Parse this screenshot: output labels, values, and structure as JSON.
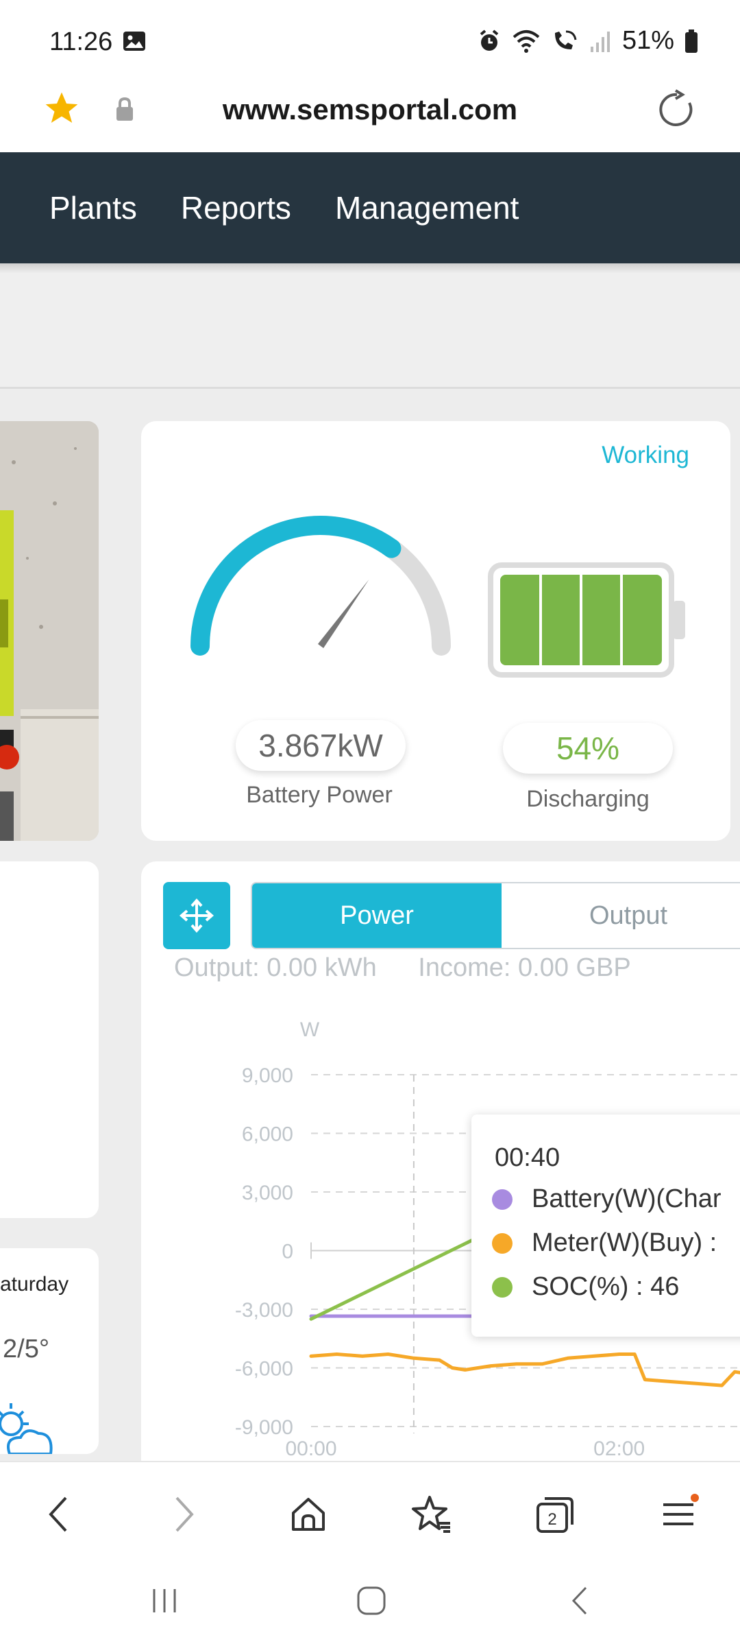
{
  "status_bar": {
    "time": "11:26",
    "battery_percent": "51%",
    "icons": [
      "image-icon",
      "alarm-icon",
      "wifi-icon",
      "wifi-calling-icon",
      "signal-icon",
      "battery-icon"
    ]
  },
  "browser": {
    "url": "www.semsportal.com"
  },
  "nav": {
    "items": [
      "Plants",
      "Reports",
      "Management"
    ]
  },
  "battery_card": {
    "status": "Working",
    "power_value": "3.867kW",
    "power_label": "Battery Power",
    "soc_value": "54%",
    "soc_label": "Discharging",
    "gauge_fraction": 0.7,
    "battery_cells": 4
  },
  "weather": {
    "day_partial": "aturday",
    "temp_partial": "2/5°"
  },
  "chart_panel": {
    "tabs": [
      "Power",
      "Output"
    ],
    "active_tab": "Power",
    "summary_output": "Output: 0.00 kWh",
    "summary_income": "Income: 0.00 GBP",
    "tooltip": {
      "time": "00:40",
      "rows": [
        {
          "label": "Battery(W)(Char",
          "color": "#a88be0"
        },
        {
          "label": "Meter(W)(Buy) :",
          "color": "#f6a828"
        },
        {
          "label": "SOC(%) : 46",
          "color": "#8cc04b"
        }
      ]
    }
  },
  "chart_data": {
    "type": "line",
    "title": "",
    "ylabel": "W",
    "ylim": [
      -9000,
      9000
    ],
    "yticks": [
      "9,000",
      "6,000",
      "3,000",
      "0",
      "-3,000",
      "-6,000",
      "-9,000"
    ],
    "xtick_labels": [
      "00:00",
      "02:00"
    ],
    "xlim": [
      0,
      190
    ],
    "series": [
      {
        "name": "Battery(W)(Char",
        "color": "#a88be0",
        "x": [
          0,
          70
        ],
        "y": [
          -3350,
          -3350
        ]
      },
      {
        "name": "Meter(W)(Buy)",
        "color": "#f6a828",
        "x": [
          0,
          10,
          20,
          30,
          40,
          50,
          55,
          60,
          70,
          80,
          90,
          100,
          110,
          120,
          126,
          130,
          140,
          150,
          160,
          165,
          170,
          175,
          180,
          185,
          190
        ],
        "y": [
          -5400,
          -5300,
          -5400,
          -5300,
          -5500,
          -5600,
          -6000,
          -6100,
          -5900,
          -5800,
          -5800,
          -5500,
          -5400,
          -5300,
          -5300,
          -6600,
          -6700,
          -6800,
          -6900,
          -6200,
          -6300,
          -6100,
          -4700,
          -4600,
          -5600
        ]
      },
      {
        "name": "SOC(%)",
        "color": "#8cc04b",
        "x": [
          0,
          70
        ],
        "y": [
          -3500,
          1000
        ]
      }
    ],
    "cursor_x": 40,
    "grid": true
  }
}
